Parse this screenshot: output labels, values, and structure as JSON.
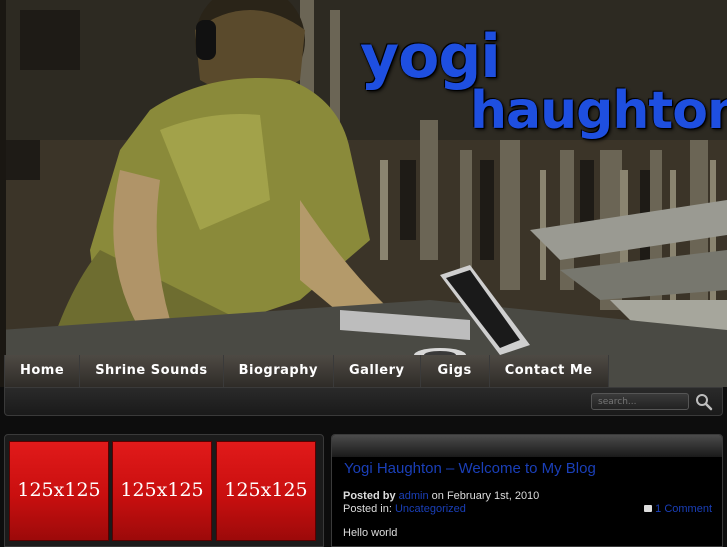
{
  "brand": {
    "logo_line1": "yogi",
    "logo_line2": "haughton"
  },
  "nav": {
    "items": [
      {
        "label": "Home"
      },
      {
        "label": "Shrine Sounds"
      },
      {
        "label": "Biography"
      },
      {
        "label": "Gallery"
      },
      {
        "label": "Gigs"
      },
      {
        "label": "Contact Me"
      }
    ]
  },
  "search": {
    "placeholder": "search..."
  },
  "ads": [
    {
      "label": "125x125"
    },
    {
      "label": "125x125"
    },
    {
      "label": "125x125"
    }
  ],
  "post": {
    "title": "Yogi Haughton – Welcome to My Blog",
    "posted_by_label": "Posted by",
    "author": "admin",
    "date_text": "on February 1st, 2010",
    "posted_in_label": "Posted in:",
    "category": "Uncategorized",
    "comments": "1 Comment",
    "body": "Hello world"
  },
  "colors": {
    "link_blue": "#1a3fb8",
    "logo_blue": "#1e4fe0",
    "ad_red": "#d61414"
  },
  "icons": {
    "search": "magnifier-icon",
    "comment": "speech-bubble-icon"
  }
}
